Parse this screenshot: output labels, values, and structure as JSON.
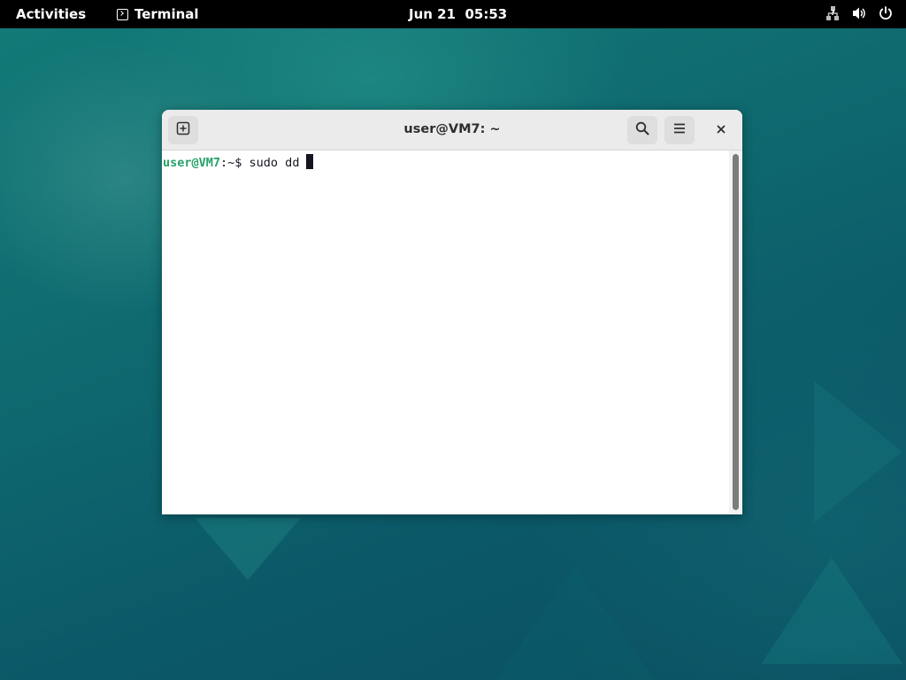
{
  "topbar": {
    "activities_label": "Activities",
    "app_name": "Terminal",
    "app_icon": "terminal-icon",
    "clock": "Jun 21  05:53",
    "tray_icons": [
      "network-icon",
      "volume-icon",
      "power-icon"
    ]
  },
  "window": {
    "title": "user@VM7: ~",
    "buttons": {
      "new_tab_icon": "new-tab-icon",
      "search_icon": "search-icon",
      "menu_icon": "hamburger-menu-icon",
      "close_icon": "close-icon"
    }
  },
  "terminal": {
    "prompt_user_host": "user@VM7",
    "prompt_rest": ":~$ ",
    "command": "sudo dd"
  },
  "colors": {
    "prompt_green": "#26a269",
    "topbar": "#000000",
    "headerbar": "#ebebeb"
  }
}
